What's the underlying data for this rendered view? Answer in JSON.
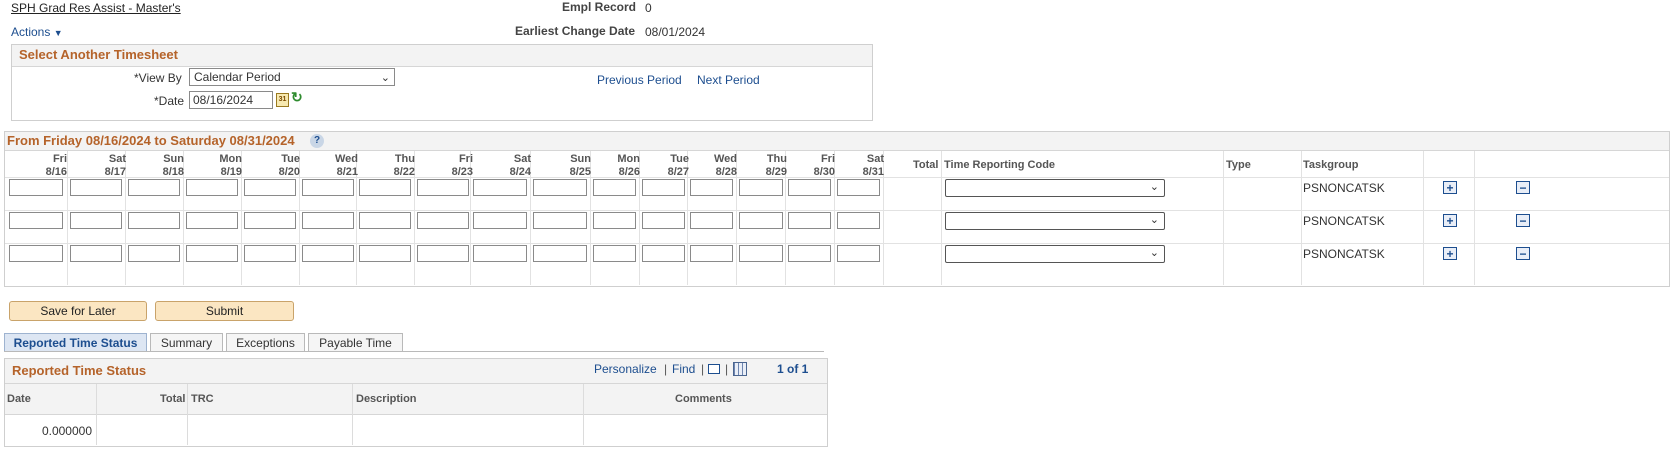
{
  "header": {
    "job_title": "SPH Grad Res Assist - Master's",
    "actions_label": "Actions",
    "empl_record_label": "Empl Record",
    "empl_record_value": "0",
    "earliest_change_label": "Earliest Change Date",
    "earliest_change_value": "08/01/2024"
  },
  "select_timesheet": {
    "title": "Select Another Timesheet",
    "view_by_label": "*View By",
    "view_by_value": "Calendar Period",
    "date_label": "*Date",
    "date_value": "08/16/2024",
    "previous_period": "Previous Period",
    "next_period": "Next Period"
  },
  "timesheet": {
    "title": "From Friday 08/16/2024 to Saturday 08/31/2024",
    "days": [
      {
        "dow": "Fri",
        "date": "8/16"
      },
      {
        "dow": "Sat",
        "date": "8/17"
      },
      {
        "dow": "Sun",
        "date": "8/18"
      },
      {
        "dow": "Mon",
        "date": "8/19"
      },
      {
        "dow": "Tue",
        "date": "8/20"
      },
      {
        "dow": "Wed",
        "date": "8/21"
      },
      {
        "dow": "Thu",
        "date": "8/22"
      },
      {
        "dow": "Fri",
        "date": "8/23"
      },
      {
        "dow": "Sat",
        "date": "8/24"
      },
      {
        "dow": "Sun",
        "date": "8/25"
      },
      {
        "dow": "Mon",
        "date": "8/26"
      },
      {
        "dow": "Tue",
        "date": "8/27"
      },
      {
        "dow": "Wed",
        "date": "8/28"
      },
      {
        "dow": "Thu",
        "date": "8/29"
      },
      {
        "dow": "Fri",
        "date": "8/30"
      },
      {
        "dow": "Sat",
        "date": "8/31"
      }
    ],
    "col_total": "Total",
    "col_trc": "Time Reporting Code",
    "col_type": "Type",
    "col_taskgroup": "Taskgroup",
    "rows": [
      {
        "taskgroup": "PSNONCATSK"
      },
      {
        "taskgroup": "PSNONCATSK"
      },
      {
        "taskgroup": "PSNONCATSK"
      }
    ]
  },
  "buttons": {
    "save_later": "Save for Later",
    "submit": "Submit"
  },
  "tabs": [
    "Reported Time Status",
    "Summary",
    "Exceptions",
    "Payable Time"
  ],
  "reported_status": {
    "title": "Reported Time Status",
    "personalize": "Personalize",
    "find": "Find",
    "pager": "1 of 1",
    "columns": [
      "Date",
      "Total",
      "TRC",
      "Description",
      "Comments"
    ],
    "rows": [
      {
        "date": "",
        "total": "0.000000",
        "trc": "",
        "description": "",
        "comments": ""
      }
    ]
  },
  "colors": {
    "title_orange": "#b5632a",
    "link_blue": "#1d4e8f",
    "button_fill": "#fbe6c2"
  }
}
